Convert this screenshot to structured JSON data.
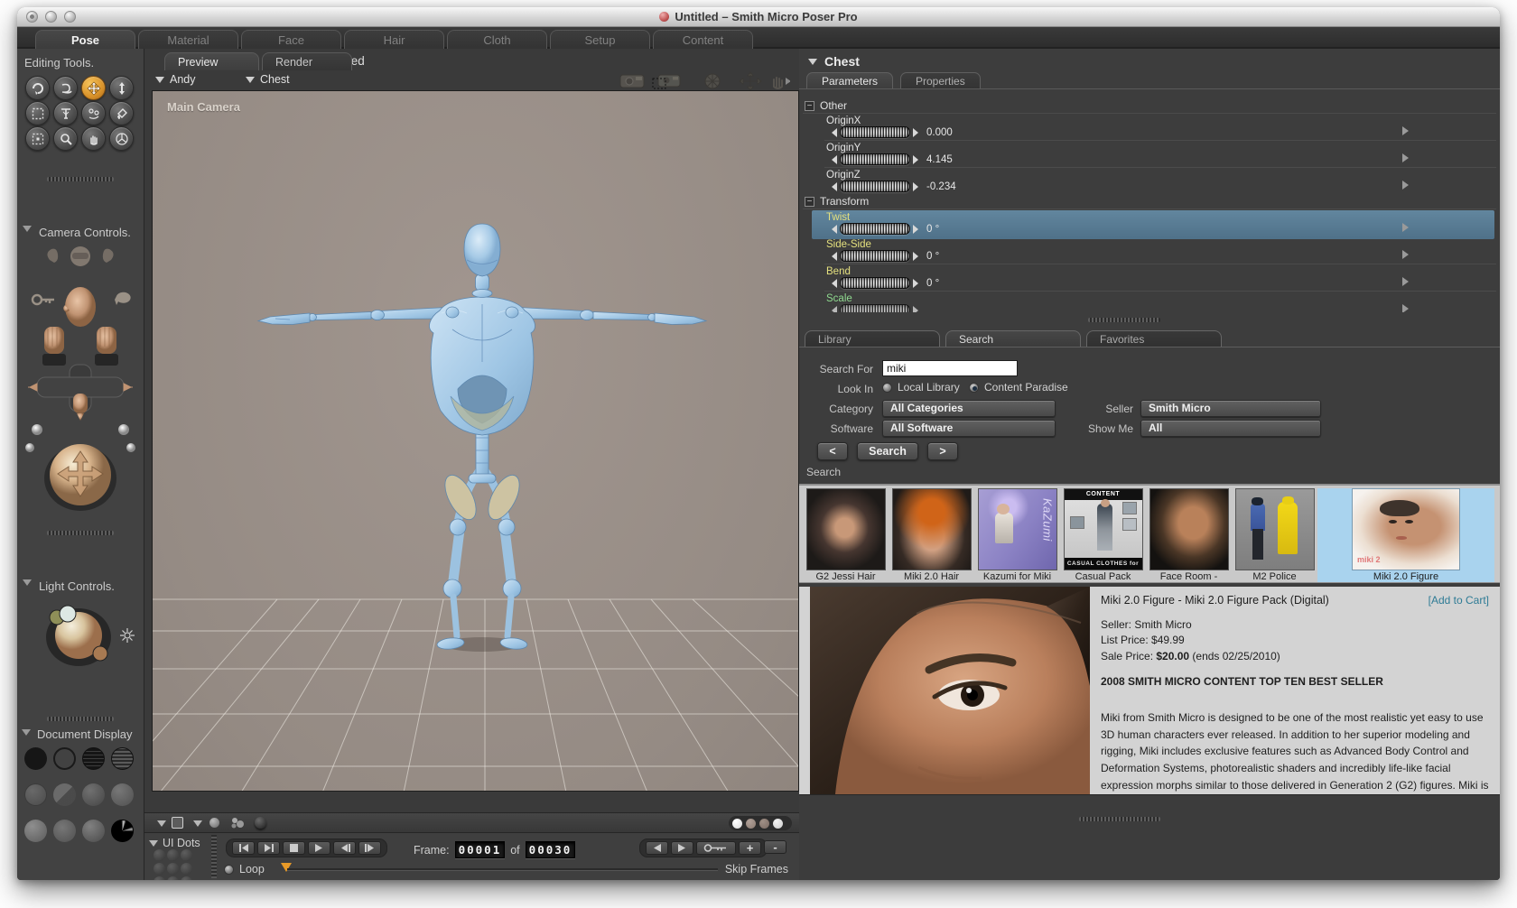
{
  "window": {
    "title": "Untitled – Smith Micro Poser Pro"
  },
  "main_tabs": {
    "items": [
      "Pose",
      "Material",
      "Face",
      "Hair",
      "Cloth",
      "Setup",
      "Content"
    ],
    "active": "Pose"
  },
  "sidebar": {
    "editing_tools_label": "Editing Tools.",
    "camera_controls_label": "Camera Controls.",
    "light_controls_label": "Light Controls.",
    "document_display_label": "Document Display"
  },
  "document": {
    "view_tabs": [
      "Preview",
      "Render"
    ],
    "doc_name": "Untitled",
    "figure_selector": "Andy",
    "actor_selector": "Chest",
    "camera_label": "Main Camera"
  },
  "animation": {
    "ui_dots_label": "UI Dots",
    "frame_label": "Frame:",
    "frame_current": "00001",
    "frame_of": "of",
    "frame_total": "00030",
    "loop_label": "Loop",
    "skip_frames_label": "Skip Frames",
    "plus_label": "+",
    "minus_label": "-"
  },
  "parameters_panel": {
    "actor_name": "Chest",
    "tabs": [
      "Parameters",
      "Properties"
    ],
    "groups": [
      {
        "name": "Other",
        "items": [
          {
            "label": "OriginX",
            "value": "0.000"
          },
          {
            "label": "OriginY",
            "value": "4.145"
          },
          {
            "label": "OriginZ",
            "value": "-0.234"
          }
        ]
      },
      {
        "name": "Transform",
        "items": [
          {
            "label": "Twist",
            "value": "0 °"
          },
          {
            "label": "Side-Side",
            "value": "0 °"
          },
          {
            "label": "Bend",
            "value": "0 °"
          },
          {
            "label": "Scale",
            "value": ""
          }
        ]
      }
    ]
  },
  "library_panel": {
    "tabs": [
      "Library",
      "Search",
      "Favorites"
    ],
    "active_tab": "Search",
    "form": {
      "search_for_label": "Search For",
      "search_value": "miki",
      "look_in_label": "Look In",
      "radio_local": "Local Library",
      "radio_paradise": "Content Paradise",
      "selected_radio": "Content Paradise",
      "category_label": "Category",
      "category_value": "All Categories",
      "seller_label": "Seller",
      "seller_value": "Smith Micro",
      "software_label": "Software",
      "software_value": "All Software",
      "show_me_label": "Show Me",
      "show_me_value": "All",
      "prev_button": "<",
      "search_button": "Search",
      "next_button": ">"
    },
    "results_label": "Search",
    "results": [
      {
        "label": "G2 Jessi Hair"
      },
      {
        "label": "Miki 2.0 Hair"
      },
      {
        "label": "Kazumi for Miki",
        "brand": "KaZumi"
      },
      {
        "label": "Casual Pack",
        "header": "CONTENT",
        "footer": "CASUAL CLOTHES for MIKI"
      },
      {
        "label": "Face Room -"
      },
      {
        "label": "M2 Police"
      },
      {
        "label": "Miki 2.0 Figure",
        "logo": "miki 2"
      }
    ],
    "product": {
      "title": "Miki 2.0 Figure - Miki 2.0 Figure Pack (Digital)",
      "add_to_cart": "[Add to Cart]",
      "seller": "Seller: Smith Micro",
      "list_price": "List Price: $49.99",
      "sale_price_label": "Sale Price: ",
      "sale_price_value": "$20.00",
      "sale_price_suffix": " (ends 02/25/2010)",
      "banner": "2008 SMITH MICRO CONTENT TOP TEN BEST SELLER",
      "description": "Miki from Smith Micro is designed to be one of the most realistic yet easy to use 3D human characters ever released. In addition to her superior modeling and rigging, Miki includes exclusive features such as Advanced Body Control and Deformation Systems, photorealistic shaders and incredibly life-like facial expression morphs similar to those delivered in Generation 2 (G2) figures. Miki is Poser Face Room compatible, and is one of the most"
    }
  },
  "colors": {
    "accent_orange": "#e0992c",
    "selected_row_blue": "#557a92",
    "param_label_yellow": "#e4e07e",
    "param_label_green": "#8fd98f",
    "add_to_cart_teal": "#2e7b95",
    "thumbnail_selected_blue": "#a9d3ee",
    "viewport_taupe": "#9b9089"
  }
}
